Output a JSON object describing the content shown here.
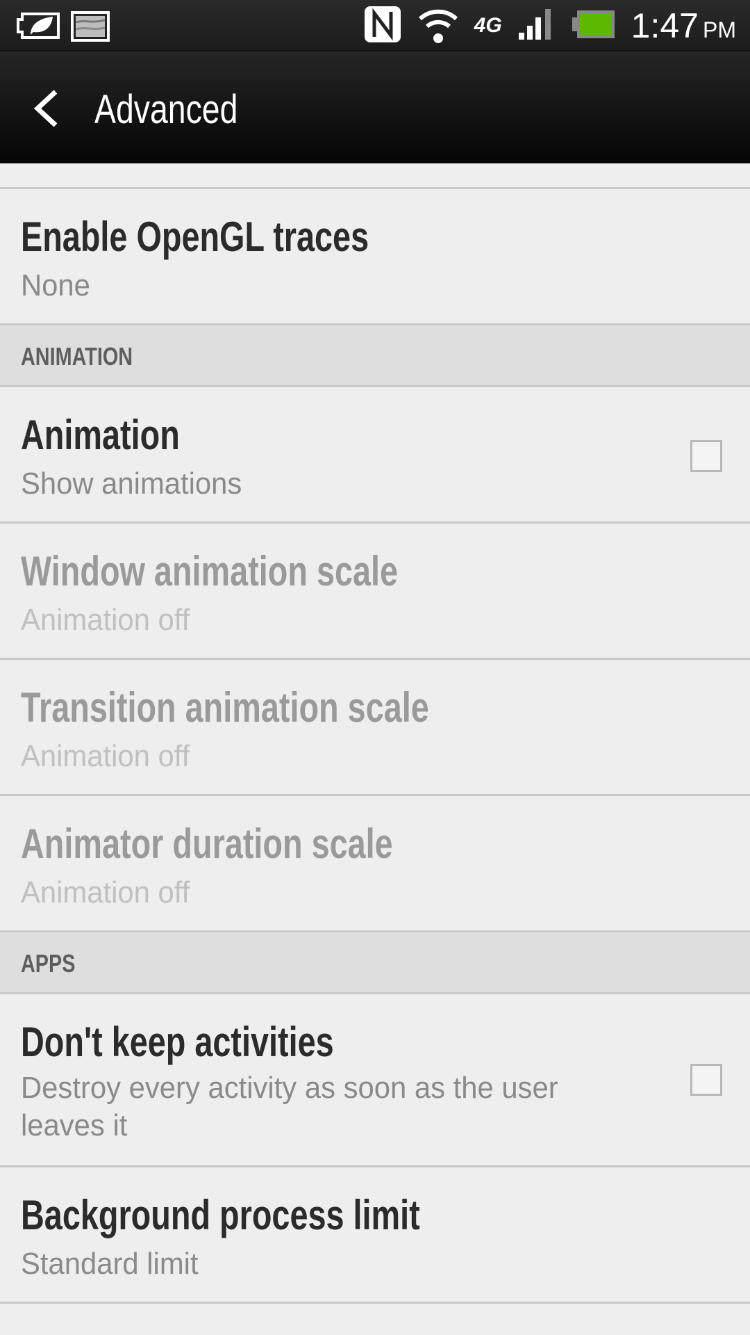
{
  "status_bar": {
    "icons": [
      "power-saver-icon",
      "gallery-notification-icon",
      "nfc-icon",
      "wifi-icon",
      "network-4g-icon",
      "signal-icon",
      "battery-icon"
    ],
    "network_label": "4G",
    "time": "1:47",
    "ampm": "PM",
    "battery_color": "#5cb800"
  },
  "action_bar": {
    "title": "Advanced",
    "back_icon": "chevron-left-icon"
  },
  "items": [
    {
      "title": "Enable OpenGL traces",
      "summary": "None"
    },
    {
      "title": "Animation",
      "summary": "Show animations",
      "checked": false
    },
    {
      "title": "Window animation scale",
      "summary": "Animation off",
      "enabled": false
    },
    {
      "title": "Transition animation scale",
      "summary": "Animation off",
      "enabled": false
    },
    {
      "title": "Animator duration scale",
      "summary": "Animation off",
      "enabled": false
    },
    {
      "title": "Don't keep activities",
      "summary": "Destroy every activity as soon as the user leaves it",
      "checked": false
    },
    {
      "title": "Background process limit",
      "summary": "Standard limit"
    }
  ],
  "sections": {
    "animation": "ANIMATION",
    "apps": "APPS"
  }
}
